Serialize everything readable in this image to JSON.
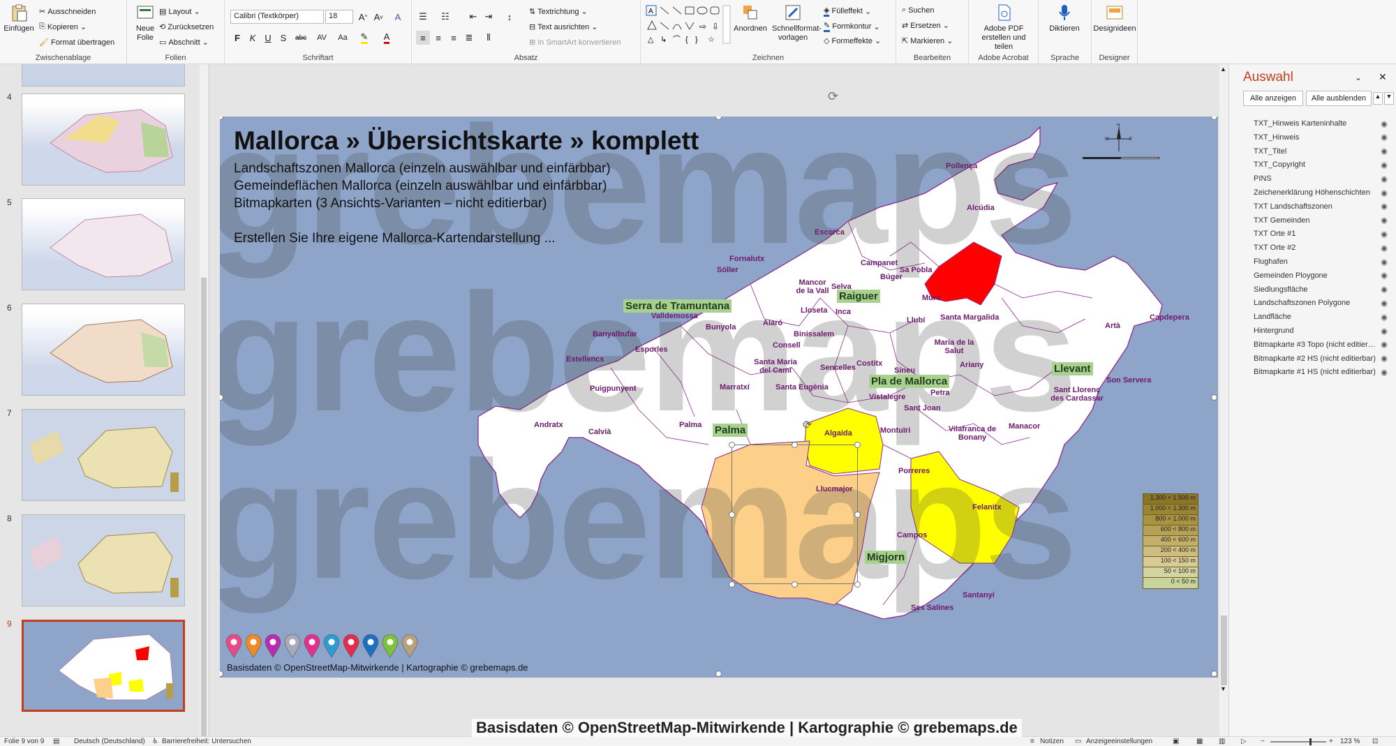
{
  "ribbon": {
    "clipboard": {
      "paste": "Einfügen",
      "cut": "Ausschneiden",
      "copy": "Kopieren",
      "format_painter": "Format übertragen",
      "label": "Zwischenablage"
    },
    "slides": {
      "new_slide": "Neue Folie",
      "layout": "Layout",
      "reset": "Zurücksetzen",
      "section": "Abschnitt",
      "label": "Folien"
    },
    "font": {
      "family": "Calibri (Textkörper)",
      "size": "18",
      "bold": "F",
      "italic": "K",
      "underline": "U",
      "strike": "S",
      "shadow": "abc",
      "spacing": "AV",
      "case": "Aa",
      "color_a": "A",
      "label": "Schriftart"
    },
    "paragraph": {
      "text_direction": "Textrichtung",
      "align_text": "Text ausrichten",
      "smartart": "In SmartArt konvertieren",
      "label": "Absatz"
    },
    "drawing": {
      "arrange": "Anordnen",
      "quick_styles": "Schnellformat-vorlagen",
      "fill": "Fülleffekt",
      "outline": "Formkontur",
      "effects": "Formeffekte",
      "label": "Zeichnen"
    },
    "editing": {
      "find": "Suchen",
      "replace": "Ersetzen",
      "select": "Markieren",
      "label": "Bearbeiten"
    },
    "acrobat": {
      "create_pdf": "Adobe PDF erstellen und teilen",
      "label": "Adobe Acrobat"
    },
    "voice": {
      "dictate": "Diktieren",
      "label": "Sprache"
    },
    "designer": {
      "ideas": "Designideen",
      "label": "Designer"
    }
  },
  "slide_panel": {
    "slides": [
      {
        "number": "4"
      },
      {
        "number": "5"
      },
      {
        "number": "6"
      },
      {
        "number": "7"
      },
      {
        "number": "8"
      },
      {
        "number": "9"
      }
    ]
  },
  "slide": {
    "title": "Mallorca » Übersichtskarte » komplett",
    "lines": [
      "Landschaftszonen Mallorca (einzeln auswählbar und einfärbbar)",
      "Gemeindeflächen Mallorca (einzeln auswählbar und einfärbbar)",
      "Bitmapkarten (3 Ansichts-Varianten – nicht editierbar)"
    ],
    "cta": "Erstellen Sie Ihre eigene Mallorca-Kartendarstellung ...",
    "copyright": "Basisdaten © OpenStreetMap-Mitwirkende | Kartographie © grebemaps.de",
    "watermark": "grebemaps",
    "zones": [
      "Serra de Tramuntana",
      "Raiguer",
      "Pla de Mallorca",
      "Llevant",
      "Palma",
      "Migjorn"
    ],
    "towns": [
      "Pollença",
      "Alcúdia",
      "Escorca",
      "Fornalutx",
      "Sóller",
      "Campanet",
      "Sa Pobla",
      "Búger",
      "Mancor de la Vall",
      "Selva",
      "Lloseta",
      "Inca",
      "Muro",
      "Santa Margalida",
      "Capdepera",
      "Artà",
      "Valldemossa",
      "Bunyola",
      "Alaró",
      "Llubí",
      "Banyalbufar",
      "Binissalem",
      "Consell",
      "Maria de la Salut",
      "Estellencs",
      "Esporles",
      "Santa Maria del Camí",
      "Sencelles",
      "Costitx",
      "Sineu",
      "Ariany",
      "Puigpunyent",
      "Marratxí",
      "Santa Eugènia",
      "Vistalegre",
      "Petra",
      "Sant Llorenç des Cardassar",
      "Son Servera",
      "Andratx",
      "Calvià",
      "Palma",
      "Algaida",
      "Montuïri",
      "Sant Joan",
      "Vilafranca de Bonany",
      "Manacor",
      "Llucmajor",
      "Porreres",
      "Felanitx",
      "Campos",
      "Santanyí",
      "Ses Salines"
    ],
    "legend": [
      "1.300 < 1.500 m",
      "1.000 < 1.300 m",
      "800 < 1.000 m",
      "600 < 800 m",
      "400 < 600 m",
      "200 < 400 m",
      "100 < 150 m",
      "50 < 100 m",
      "0 < 50 m"
    ],
    "pin_colors": [
      "#e94b8a",
      "#f08a24",
      "#b92bb0",
      "#a9a9b8",
      "#e3308f",
      "#2f9bd1",
      "#e22d4f",
      "#1d6fbf",
      "#7cc23a",
      "#b8a07e"
    ]
  },
  "selection_pane": {
    "title": "Auswahl",
    "show_all": "Alle anzeigen",
    "hide_all": "Alle ausblenden",
    "items": [
      "TXT_Hinweis Karteninhalte",
      "TXT_Hinweis",
      "TXT_Titel",
      "TXT_Copyright",
      "PINS",
      "Zeichenerklärung Höhenschichten",
      "TXT Landschaftszonen",
      "TXT Gemeinden",
      "TXT Orte #1",
      "TXT Orte #2",
      "Flughafen",
      "Gemeinden Ploygone",
      "Siedlungsfläche",
      "Landschaftszonen Polygone",
      "Landfläche",
      "Hintergrund",
      "Bitmapkarte #3 Topo (nicht editierbar)",
      "Bitmapkarte #2 HS (nicht editierbar)",
      "Bitmapkarte #1 HS (nicht editierbar)"
    ]
  },
  "status": {
    "slide_count": "Folie 9 von 9",
    "language": "Deutsch (Deutschland)",
    "accessibility": "Barrierefreiheit: Untersuchen",
    "notes": "Notizen",
    "display": "Anzeigeeinstellungen",
    "zoom": "123 %"
  },
  "overlay_caption": "Basisdaten © OpenStreetMap-Mitwirkende | Kartographie © grebemaps.de",
  "colors": {
    "sea": "#8ea4c9",
    "land": "#ffffff",
    "border": "#8b2a8d",
    "red": "#ff0000",
    "yellow": "#ffff00",
    "orange": "#fdd08a",
    "zone_label_bg": "#a9d08e",
    "accent": "#c43e1c"
  }
}
